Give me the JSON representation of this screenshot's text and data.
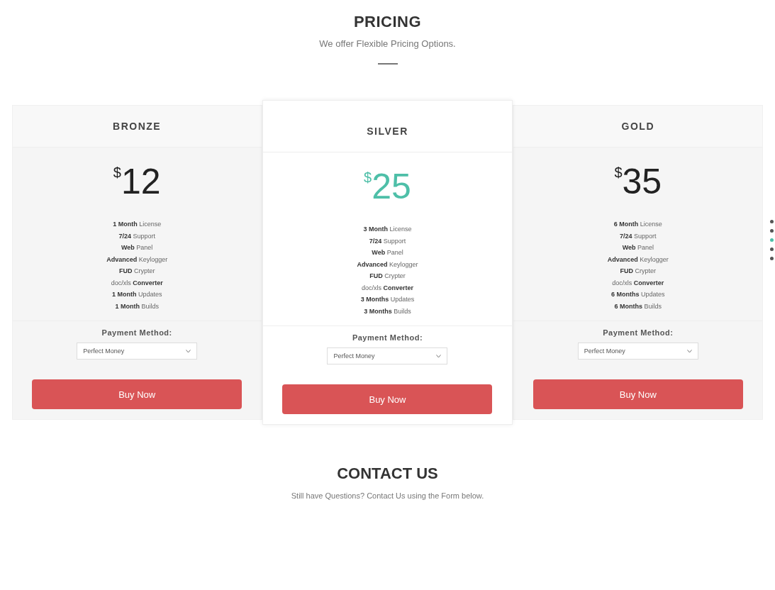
{
  "pricing": {
    "title": "PRICING",
    "subtitle": "We offer Flexible Pricing Options."
  },
  "plans": [
    {
      "name": "BRONZE",
      "currency": "$",
      "price": "12",
      "featured": false,
      "features": [
        "**1 Month** License",
        "**7/24** Support",
        "**Web** Panel",
        "**Advanced** Keylogger",
        "**FUD** Crypter",
        "doc/xls **Converter**",
        "**1 Month** Updates",
        "**1 Month** Builds"
      ],
      "payment_label": "Payment Method:",
      "payment_value": "Perfect Money",
      "button": "Buy Now"
    },
    {
      "name": "SILVER",
      "currency": "$",
      "price": "25",
      "featured": true,
      "features": [
        "**3 Month** License",
        "**7/24** Support",
        "**Web** Panel",
        "**Advanced** Keylogger",
        "**FUD** Crypter",
        "doc/xls **Converter**",
        "**3 Months** Updates",
        "**3 Months** Builds"
      ],
      "payment_label": "Payment Method:",
      "payment_value": "Perfect Money",
      "button": "Buy Now"
    },
    {
      "name": "GOLD",
      "currency": "$",
      "price": "35",
      "featured": false,
      "features": [
        "**6 Month** License",
        "**7/24** Support",
        "**Web** Panel",
        "**Advanced** Keylogger",
        "**FUD** Crypter",
        "doc/xls **Converter**",
        "**6 Months** Updates",
        "**6 Months** Builds"
      ],
      "payment_label": "Payment Method:",
      "payment_value": "Perfect Money",
      "button": "Buy Now"
    }
  ],
  "page_dots": [
    {
      "selected": false
    },
    {
      "selected": false
    },
    {
      "selected": true
    },
    {
      "selected": false
    },
    {
      "selected": false
    }
  ],
  "contact": {
    "title": "CONTACT US",
    "subtitle": "Still have Questions? Contact Us using the Form below."
  }
}
